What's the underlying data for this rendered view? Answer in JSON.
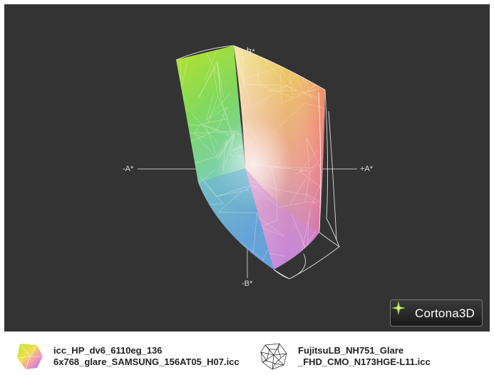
{
  "viewer": {
    "axis_labels": {
      "b_plus": "B*",
      "b_minus": "-B*",
      "a_plus": "+A*",
      "a_minus": "-A*"
    },
    "background": "#333333"
  },
  "badge": {
    "text": "Cortona3D"
  },
  "legend": [
    {
      "icon": "color-gamut-icon",
      "line1": "icc_HP_dv6_6110eg_136",
      "line2": "6x768_glare_SAMSUNG_156AT05_H07.icc"
    },
    {
      "icon": "wireframe-gamut-icon",
      "line1": "FujitsuLB_NH751_Glare",
      "line2": "_FHD_CMO_N173HGE-L11.icc"
    }
  ]
}
